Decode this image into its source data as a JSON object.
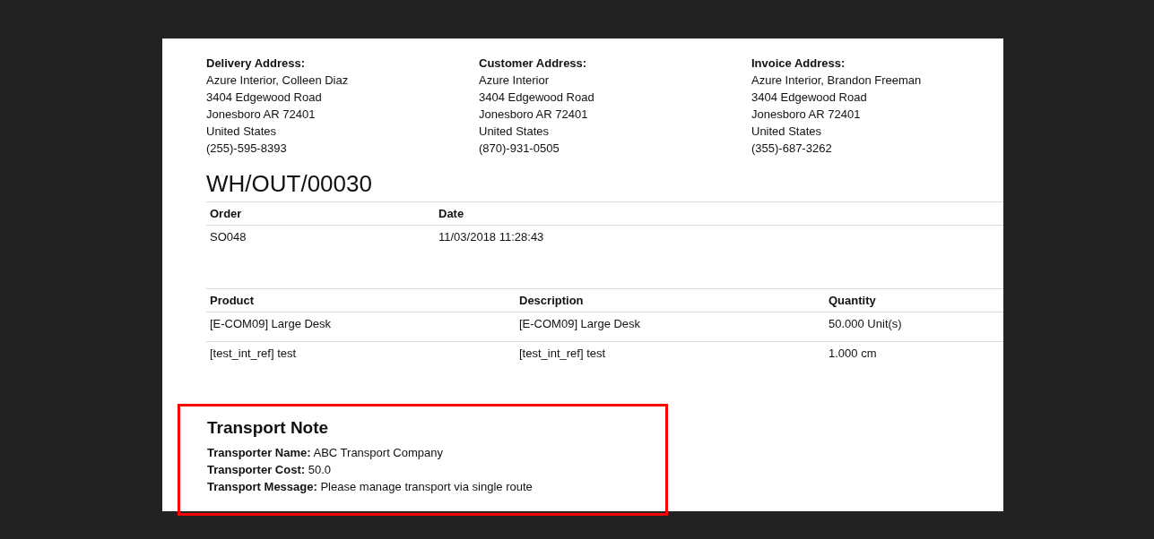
{
  "addresses": [
    {
      "label": "Delivery Address:",
      "lines": [
        "Azure Interior, Colleen Diaz",
        "3404 Edgewood Road",
        "Jonesboro AR 72401",
        "United States",
        "(255)-595-8393"
      ]
    },
    {
      "label": "Customer Address:",
      "lines": [
        "Azure Interior",
        "3404 Edgewood Road",
        "Jonesboro AR 72401",
        "United States",
        "(870)-931-0505"
      ]
    },
    {
      "label": "Invoice Address:",
      "lines": [
        "Azure Interior, Brandon Freeman",
        "3404 Edgewood Road",
        "Jonesboro AR 72401",
        "United States",
        "(355)-687-3262"
      ]
    }
  ],
  "document_title": "WH/OUT/00030",
  "order_table": {
    "columns": [
      "Order",
      "Date"
    ],
    "rows": [
      [
        "SO048",
        "11/03/2018 11:28:43"
      ]
    ]
  },
  "products_table": {
    "columns": [
      "Product",
      "Description",
      "Quantity"
    ],
    "rows": [
      [
        "[E-COM09] Large Desk",
        "[E-COM09] Large Desk",
        "50.000 Unit(s)"
      ],
      [
        "[test_int_ref] test",
        "[test_int_ref] test",
        "1.000 cm"
      ]
    ]
  },
  "transport_note": {
    "title": "Transport Note",
    "highlighted": true,
    "fields": [
      {
        "label": "Transporter Name:",
        "value": "ABC Transport Company"
      },
      {
        "label": "Transporter Cost:",
        "value": "50.0"
      },
      {
        "label": "Transport Message:",
        "value": "Please manage transport via single route"
      }
    ]
  }
}
